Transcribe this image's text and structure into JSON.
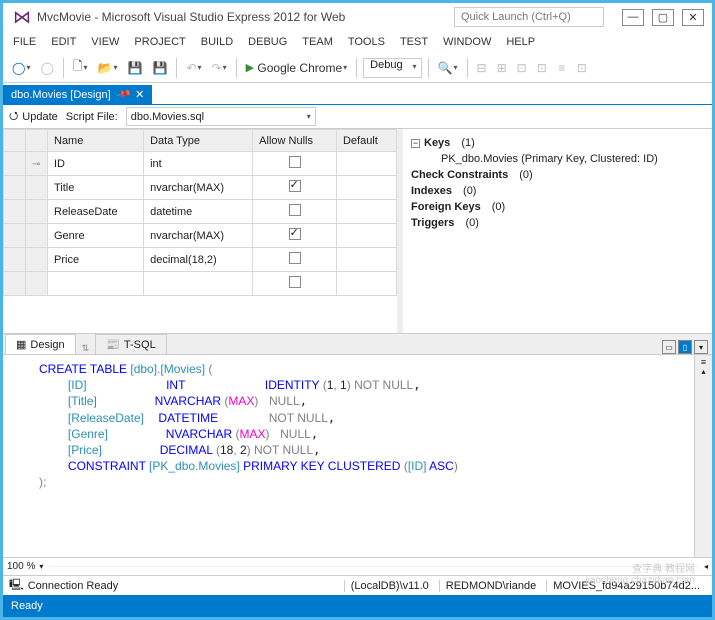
{
  "title": "MvcMovie - Microsoft Visual Studio Express 2012 for Web",
  "quickLaunchPlaceholder": "Quick Launch (Ctrl+Q)",
  "menu": [
    "FILE",
    "EDIT",
    "VIEW",
    "PROJECT",
    "BUILD",
    "DEBUG",
    "TEAM",
    "TOOLS",
    "TEST",
    "WINDOW",
    "HELP"
  ],
  "toolbar": {
    "browser": "Google Chrome",
    "config": "Debug"
  },
  "docTab": "dbo.Movies [Design]",
  "designer": {
    "updateLabel": "Update",
    "scriptFileLabel": "Script File:",
    "scriptFile": "dbo.Movies.sql"
  },
  "gridHeaders": {
    "name": "Name",
    "dataType": "Data Type",
    "allowNulls": "Allow Nulls",
    "default": "Default"
  },
  "columns": [
    {
      "pk": true,
      "name": "ID",
      "type": "int",
      "allowNulls": false
    },
    {
      "pk": false,
      "name": "Title",
      "type": "nvarchar(MAX)",
      "allowNulls": true
    },
    {
      "pk": false,
      "name": "ReleaseDate",
      "type": "datetime",
      "allowNulls": false
    },
    {
      "pk": false,
      "name": "Genre",
      "type": "nvarchar(MAX)",
      "allowNulls": true
    },
    {
      "pk": false,
      "name": "Price",
      "type": "decimal(18,2)",
      "allowNulls": false
    }
  ],
  "props": {
    "keysLabel": "Keys",
    "keysCount": "(1)",
    "keysChild": "PK_dbo.Movies (Primary Key, Clustered: ID)",
    "checkLabel": "Check Constraints",
    "checkCount": "(0)",
    "indexesLabel": "Indexes",
    "indexesCount": "(0)",
    "fkLabel": "Foreign Keys",
    "fkCount": "(0)",
    "trigLabel": "Triggers",
    "trigCount": "(0)"
  },
  "innerTabs": {
    "design": "Design",
    "tsql": "T-SQL"
  },
  "sql": {
    "l1a": "CREATE TABLE ",
    "l1b": "[dbo]",
    "l1c": ".",
    "l1d": "[Movies]",
    "l1e": " (",
    "l2a": "[ID]",
    "l2b": "INT",
    "l2c": "IDENTITY ",
    "l2d": "(",
    "l2e": "1",
    "l2f": ", ",
    "l2g": "1",
    "l2h": ") ",
    "l2i": "NOT NULL",
    "l3a": "[Title]",
    "l3b": "NVARCHAR ",
    "l3c": "(",
    "l3d": "MAX",
    "l3e": ") ",
    "l3f": "NULL",
    "l4a": "[ReleaseDate]",
    "l4b": "DATETIME",
    "l4c": "NOT NULL",
    "l5a": "[Genre]",
    "l5b": "NVARCHAR ",
    "l5c": "(",
    "l5d": "MAX",
    "l5e": ") ",
    "l5f": "NULL",
    "l6a": "[Price]",
    "l6b": "DECIMAL ",
    "l6c": "(",
    "l6d": "18",
    "l6e": ", ",
    "l6f": "2",
    "l6g": ") ",
    "l6h": "NOT NULL",
    "l7a": "CONSTRAINT ",
    "l7b": "[PK_dbo.Movies]",
    "l7c": " PRIMARY KEY CLUSTERED ",
    "l7d": "(",
    "l7e": "[ID]",
    "l7f": " ASC",
    "l7g": ")",
    "l8": ");"
  },
  "zoom": "100 %",
  "footer": {
    "conn": "Connection Ready",
    "server": "(LocalDB)\\v11.0",
    "user": "REDMOND\\riande",
    "db": "MOVIES_fd94a29150b74d2..."
  },
  "status": "Ready",
  "watermark1": "查字典 教程网",
  "watermark2": "jiaocheng.chazidian.com"
}
